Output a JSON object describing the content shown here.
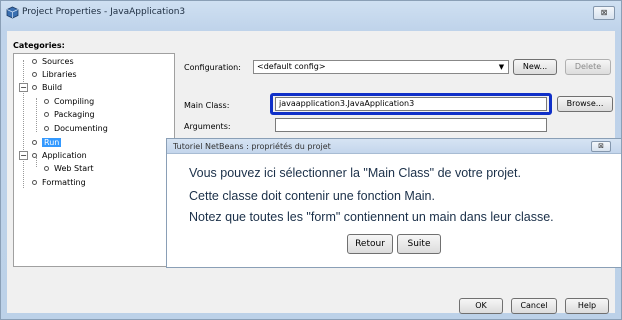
{
  "window": {
    "title": "Project Properties - JavaApplication3",
    "close_label": "⊠"
  },
  "categories": {
    "label": "Categories:",
    "items": [
      {
        "label": "Sources",
        "icon": "node-dot-icon"
      },
      {
        "label": "Libraries",
        "icon": "node-dot-icon"
      },
      {
        "label": "Build",
        "icon": "collapse-icon",
        "expander": "−"
      },
      {
        "label": "Compiling",
        "icon": "node-dot-icon"
      },
      {
        "label": "Packaging",
        "icon": "node-dot-icon"
      },
      {
        "label": "Documenting",
        "icon": "node-dot-icon"
      },
      {
        "label": "Run",
        "icon": "node-dot-icon",
        "selected": true
      },
      {
        "label": "Application",
        "icon": "collapse-icon",
        "expander": "−"
      },
      {
        "label": "Web Start",
        "icon": "node-dot-icon"
      },
      {
        "label": "Formatting",
        "icon": "node-dot-icon"
      }
    ]
  },
  "form": {
    "configuration_label": "Configuration:",
    "configuration_value": "<default config>",
    "new_button": "New...",
    "delete_button": "Delete",
    "main_class_label": "Main Class:",
    "main_class_value": "javaapplication3.JavaApplication3",
    "browse_button": "Browse...",
    "arguments_label": "Arguments:",
    "arguments_value": ""
  },
  "tooltip": {
    "title": "Tutoriel NetBeans : propriétés du projet",
    "close_label": "⊠",
    "lines": [
      "Vous pouvez ici sélectionner la \"Main Class\" de votre projet.",
      "Cette classe doit contenir une fonction Main.",
      "Notez que toutes les \"form\" contiennent un main dans leur classe."
    ],
    "back_button": "Retour",
    "next_button": "Suite"
  },
  "footer": {
    "ok_button": "OK",
    "cancel_button": "Cancel",
    "help_button": "Help"
  },
  "colors": {
    "highlight": "#1030c8",
    "selection": "#3399ff"
  }
}
